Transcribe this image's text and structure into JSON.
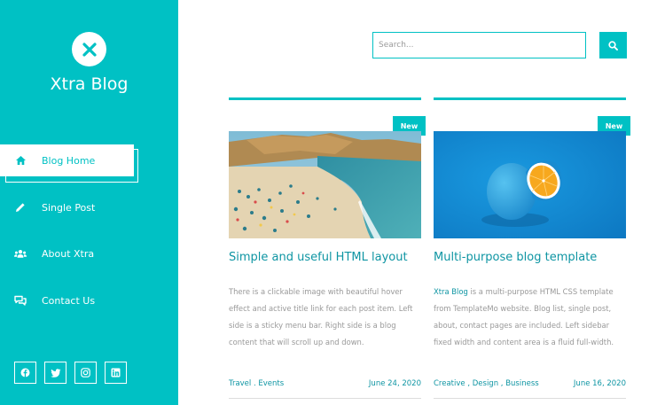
{
  "brand": {
    "name": "Xtra Blog",
    "logo_icon": "close-x-icon"
  },
  "sidebar": {
    "items": [
      {
        "label": "Blog Home",
        "icon": "home-icon",
        "active": true
      },
      {
        "label": "Single Post",
        "icon": "pen-icon",
        "active": false
      },
      {
        "label": "About Xtra",
        "icon": "users-icon",
        "active": false
      },
      {
        "label": "Contact Us",
        "icon": "comments-icon",
        "active": false
      }
    ],
    "social": [
      "facebook-icon",
      "twitter-icon",
      "instagram-icon",
      "linkedin-icon"
    ]
  },
  "search": {
    "placeholder": "Search...",
    "button_icon": "search-icon"
  },
  "posts": [
    {
      "badge": "New",
      "title": "Simple and useful HTML layout",
      "excerpt": "There is a clickable image with beautiful hover effect and active title link for each post item. Left side is a sticky menu bar. Right side is a blog content that will scroll up and down.",
      "categories": "Travel . Events",
      "date": "June 24, 2020"
    },
    {
      "badge": "New",
      "title": "Multi-purpose blog template",
      "excerpt_link": "Xtra Blog",
      "excerpt": " is a multi-purpose HTML CSS template from TemplateMo website. Blog list, single post, about, contact pages are included. Left sidebar fixed width and content area is a fluid full-width.",
      "categories": "Creative , Design , Business",
      "date": "June 16, 2020"
    }
  ],
  "colors": {
    "accent": "#00c1c4",
    "link": "#0e95a3",
    "text_muted": "#999999"
  }
}
